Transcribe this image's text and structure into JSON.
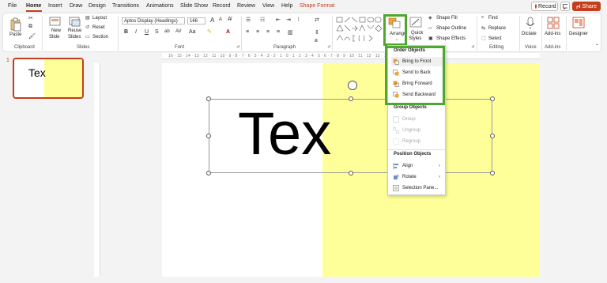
{
  "menu": {
    "items": [
      "File",
      "Home",
      "Insert",
      "Draw",
      "Design",
      "Transitions",
      "Animations",
      "Slide Show",
      "Record",
      "Review",
      "View",
      "Help",
      "Shape Format"
    ],
    "active": "Home",
    "record_label": "Record",
    "share_label": "Share"
  },
  "ribbon": {
    "clipboard": {
      "paste": "Paste",
      "label": "Clipboard"
    },
    "slides": {
      "new_slide": "New",
      "new_slide2": "Slide",
      "reuse": "Reuse",
      "reuse2": "Slides",
      "layout": "Layout",
      "reset": "Reset",
      "section": "Section",
      "label": "Slides"
    },
    "font": {
      "font_name": "Aptos Display (Headings)",
      "font_size": "166",
      "label": "Font"
    },
    "paragraph": {
      "label": "Paragraph"
    },
    "drawing": {
      "arrange": "Arrange",
      "quick_styles": "Quick",
      "quick_styles2": "Styles",
      "shape_fill": "Shape Fill",
      "shape_outline": "Shape Outline",
      "shape_effects": "Shape Effects"
    },
    "editing": {
      "find": "Find",
      "replace": "Replace",
      "select": "Select",
      "label": "Editing"
    },
    "voice": {
      "dictate": "Dictate",
      "label": "Voice"
    },
    "addins": {
      "addins": "Add-ins",
      "label": "Add-ins"
    },
    "designer": {
      "designer": "Designer"
    }
  },
  "ruler_text": "16 · 15 · 14 · 13 · 12 · 11 · 10 · 9 · 8 · 7 · 6 · 5 · 4 · 3 · 2 · 1 · 0 · 1 · 2 · 3 · 4 · 5 · 6 · 7 · 8 · 9 · 10 · 11 · 12 · 13 · 14 · 15 · 16",
  "thumbnail": {
    "number": "1",
    "text": "Tex"
  },
  "slide": {
    "text": "Tex"
  },
  "arrange_menu": {
    "order_header": "Order Objects",
    "order_items": [
      "Bring to Front",
      "Send to Back",
      "Bring Forward",
      "Send Backward"
    ],
    "group_header": "Group Objects",
    "group_items": [
      "Group",
      "Ungroup",
      "Regroup"
    ],
    "position_header": "Position Objects",
    "position_items": [
      "Align",
      "Rotate",
      "Selection Pane..."
    ]
  },
  "colors": {
    "accent": "#c43e1c",
    "highlight": "#4ea72e",
    "slide_fill": "#ffff99"
  }
}
